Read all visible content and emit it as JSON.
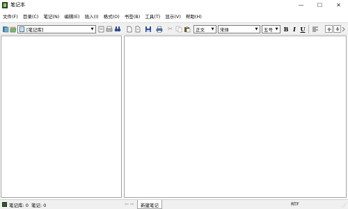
{
  "window": {
    "title": "笔记本",
    "controls": {
      "minimize": "—",
      "maximize": "☐",
      "close": "✕"
    }
  },
  "menu": [
    {
      "label": "文件(F)"
    },
    {
      "label": "目录(C)"
    },
    {
      "label": "笔记(N)"
    },
    {
      "label": "编辑(E)"
    },
    {
      "label": "插入(I)"
    },
    {
      "label": "格式(O)"
    },
    {
      "label": "书签(B)"
    },
    {
      "label": "工具(T)"
    },
    {
      "label": "显示(V)"
    },
    {
      "label": "帮助(H)"
    }
  ],
  "toolbar": {
    "notebook_combo": "[笔记库]",
    "style_combo": "正文",
    "font_combo": "宋体",
    "size_combo": "五号",
    "bold": "B",
    "italic": "I",
    "underline": "U"
  },
  "status": {
    "notebook_count": "笔记库: 0",
    "note_count": "笔记: 0",
    "tab_label": "新建笔记",
    "format": "RTF"
  },
  "colors": {
    "toolbar_bg": "#f0f0f0",
    "pane_border": "#a0a0a0",
    "app_icon": "#2f5a22"
  }
}
